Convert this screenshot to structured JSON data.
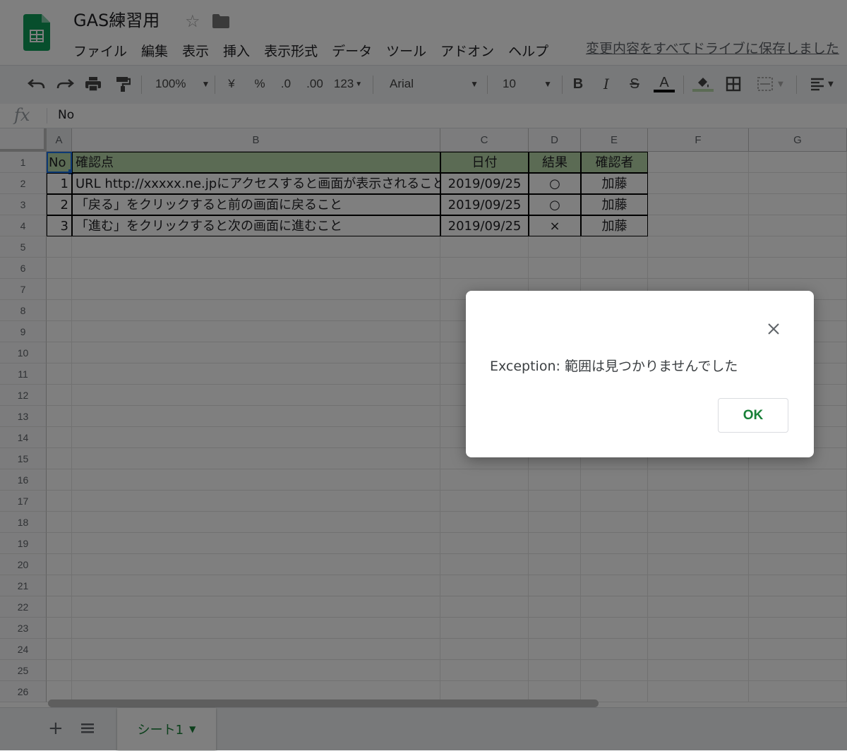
{
  "header": {
    "title": "GAS練習用",
    "menu": [
      "ファイル",
      "編集",
      "表示",
      "挿入",
      "表示形式",
      "データ",
      "ツール",
      "アドオン",
      "ヘルプ"
    ],
    "save_status": "変更内容をすべてドライブに保存しました"
  },
  "toolbar": {
    "zoom": "100%",
    "currency": "¥",
    "percent": "%",
    "decimal_decrease": ".0",
    "decimal_increase": ".00",
    "more_formats": "123",
    "font": "Arial",
    "font_size": "10",
    "bold": "B",
    "italic": "I",
    "strike": "S",
    "text_color": "A"
  },
  "formula_bar": {
    "fx": "fx",
    "value": "No"
  },
  "grid": {
    "columns": [
      "A",
      "B",
      "C",
      "D",
      "E",
      "F",
      "G"
    ],
    "rows": [
      "1",
      "2",
      "3",
      "4",
      "5",
      "6",
      "7",
      "8",
      "9",
      "10",
      "11",
      "12",
      "13",
      "14",
      "15",
      "16",
      "17",
      "18",
      "19",
      "20",
      "21",
      "22",
      "23",
      "24",
      "25",
      "26"
    ],
    "header_row": [
      "No",
      "確認点",
      "日付",
      "結果",
      "確認者"
    ],
    "data_rows": [
      [
        "1",
        "URL http://xxxxx.ne.jpにアクセスすると画面が表示されること",
        "2019/09/25",
        "○",
        "加藤"
      ],
      [
        "2",
        "「戻る」をクリックすると前の画面に戻ること",
        "2019/09/25",
        "○",
        "加藤"
      ],
      [
        "3",
        "「進む」をクリックすると次の画面に進むこと",
        "2019/09/25",
        "×",
        "加藤"
      ]
    ],
    "header_color": "#b7d7a8"
  },
  "footer": {
    "sheet_name": "シート1"
  },
  "dialog": {
    "message": "Exception: 範囲は見つかりませんでした",
    "ok_label": "OK"
  },
  "colors": {
    "accent_green": "#188038",
    "selection_blue": "#1a73e8"
  }
}
